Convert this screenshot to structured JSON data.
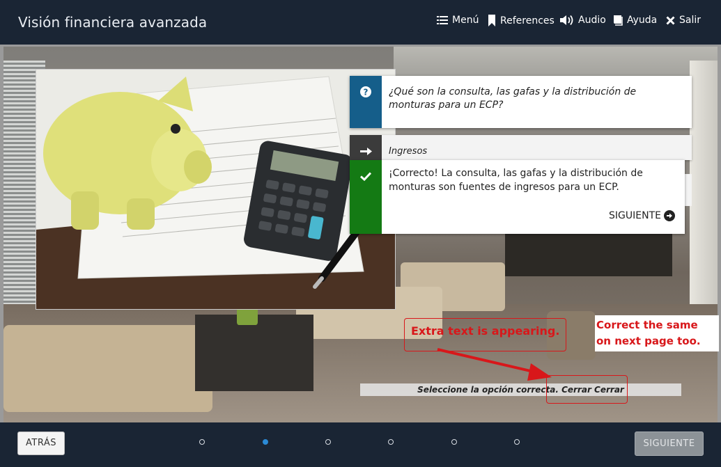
{
  "header": {
    "title": "Visión financiera avanzada",
    "nav": [
      {
        "label": "Menú",
        "icon": "list-icon"
      },
      {
        "label": "References",
        "icon": "bookmark-icon"
      },
      {
        "label": "Audio",
        "icon": "speaker-icon"
      },
      {
        "label": "Ayuda",
        "icon": "book-icon"
      },
      {
        "label": "Salir",
        "icon": "close-icon"
      }
    ]
  },
  "question": {
    "text": "¿Qué son la consulta, las gafas y la distribución de monturas para un ECP?",
    "icon": "question-icon"
  },
  "answer": {
    "label": "Ingresos",
    "icon": "arrow-right-icon"
  },
  "feedback": {
    "text": "¡Correcto! La consulta, las gafas y la distribución de monturas son fuentes de ingresos para un ECP.",
    "next_label": "SIGUIENTE",
    "icon": "check-icon"
  },
  "instruction": {
    "text": "Seleccione la opción correcta. Cerrar Cerrar"
  },
  "annotations": {
    "extra_text": "Extra text is appearing.",
    "note": "Correct the same on next page too."
  },
  "footer": {
    "back_label": "ATRÁS",
    "next_label": "SIGUIENTE",
    "page_count": 6,
    "current_page": 2
  },
  "colors": {
    "header_bg": "#1a2534",
    "question_blue": "#155e8a",
    "answer_dark": "#3b3b3b",
    "correct_green": "#147a14",
    "annotation_red": "#d8171a",
    "active_dot": "#2b8ad6"
  }
}
